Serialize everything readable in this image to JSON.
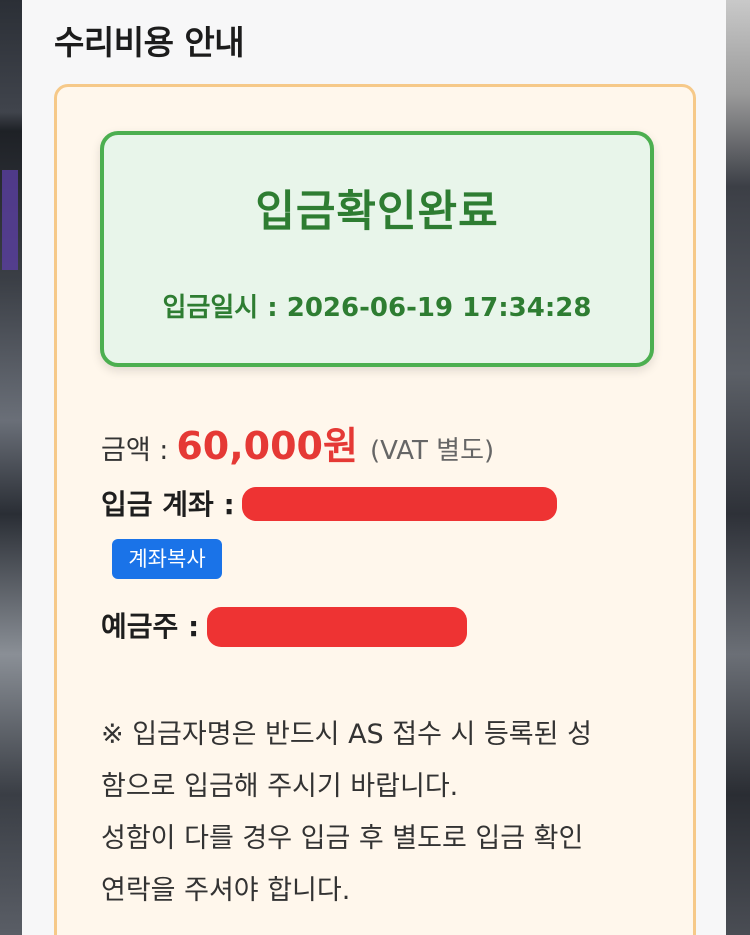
{
  "page": {
    "title": "수리비용 안내"
  },
  "status": {
    "title": "입금확인완료",
    "date_label": "입금일시 : 2026-06-19 17:34:28"
  },
  "payment": {
    "amount_label": "금액 :",
    "amount_value": "60,000원",
    "amount_note": "(VAT 별도)",
    "account_label": "입금 계좌 :",
    "copy_button": "계좌복사",
    "holder_label": "예금주 :"
  },
  "notice": {
    "line1": "※ 입금자명은 반드시 AS 접수 시 등록된 성",
    "line2": "함으로 입금해 주시기 바랍니다.",
    "line3": "성함이 다를 경우 입금 후 별도로 입금 확인",
    "line4": "연락을 주셔야 합니다."
  },
  "colors": {
    "success_green": "#2e7d32",
    "amount_red": "#e53935",
    "button_blue": "#1a73e8",
    "card_border": "#f6c989"
  }
}
